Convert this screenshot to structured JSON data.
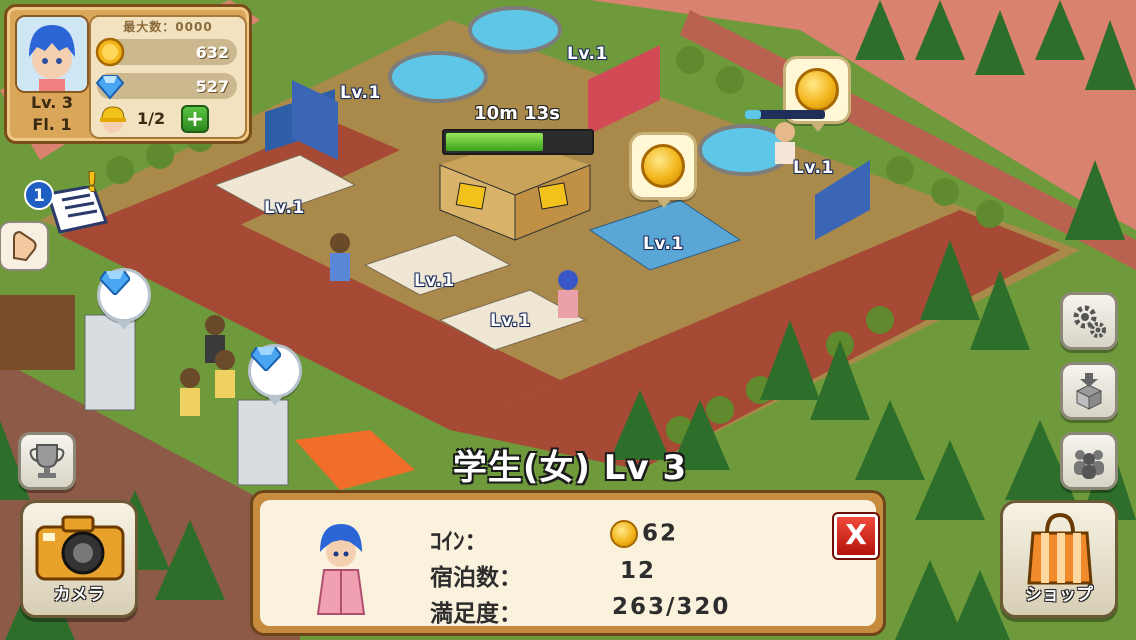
{
  "hud": {
    "player_level": "Lv. 3",
    "floor": "Fl. 1",
    "max_label": "最大数：0000",
    "coins": "632",
    "gems": "527",
    "workers": "1/2",
    "add_worker_label": "+"
  },
  "notification": {
    "count": "1",
    "alert": "!"
  },
  "world": {
    "timer": "10m 13s",
    "timer_progress": 0.68,
    "room_labels": [
      "Lv.1",
      "Lv.1",
      "Lv.1",
      "Lv.1",
      "Lv.1",
      "Lv.1",
      "Lv.1",
      "Lv.1"
    ]
  },
  "buttons": {
    "camera_label": "カメラ",
    "shop_label": "ショップ"
  },
  "guest": {
    "title": "学生(女) Lv 3",
    "coin_label": "ｺｲﾝ：",
    "coin_value": "62",
    "stays_label": "宿泊数：",
    "stays_value": "12",
    "satisfaction_label": "満足度：",
    "satisfaction_value": "263/320",
    "close_label": "X"
  }
}
